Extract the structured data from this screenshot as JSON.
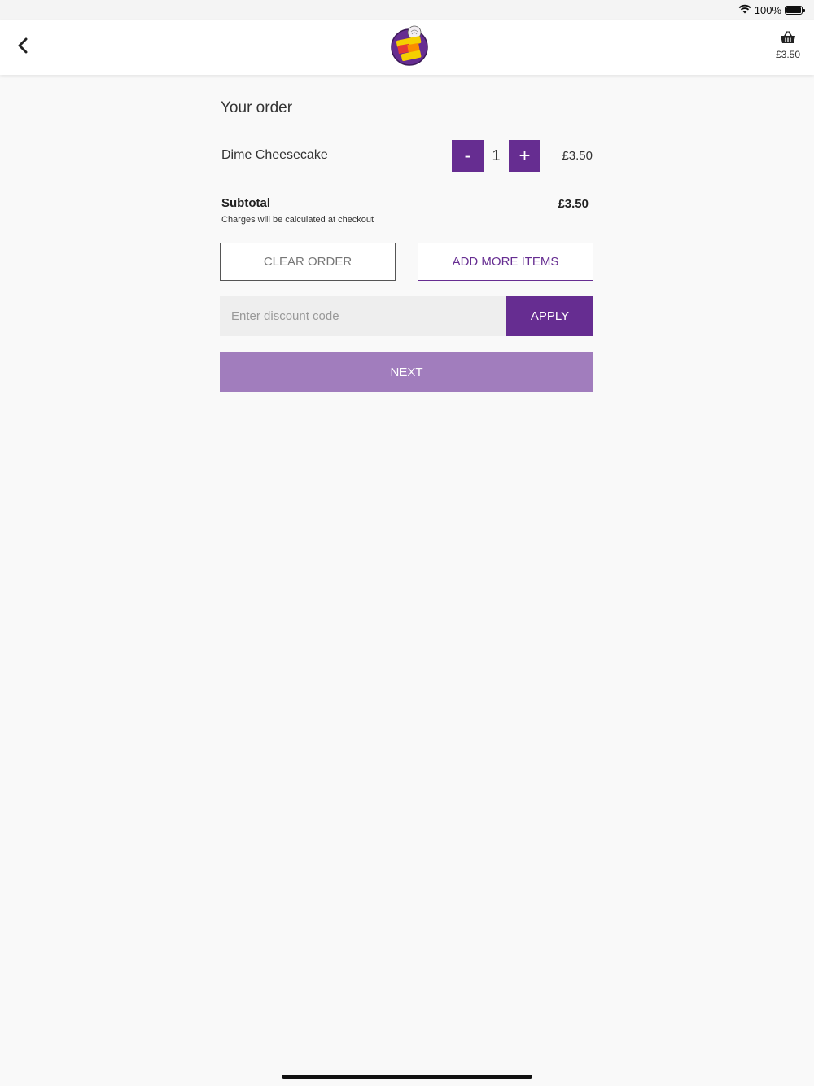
{
  "status_bar": {
    "battery_text": "100%",
    "battery_level": 1.0
  },
  "header": {
    "back_icon": "chevron-left-icon",
    "logo_name": "sweet-shop-logo",
    "basket_icon": "basket-icon",
    "basket_total": "£3.50"
  },
  "order": {
    "title": "Your order",
    "items": [
      {
        "name": "Dime Cheesecake",
        "quantity": "1",
        "price": "£3.50",
        "minus_label": "-",
        "plus_label": "+"
      }
    ],
    "subtotal_label": "Subtotal",
    "subtotal_value": "£3.50",
    "charges_note": "Charges will be calculated at checkout"
  },
  "actions": {
    "clear_label": "CLEAR ORDER",
    "add_more_label": "ADD MORE ITEMS",
    "discount_placeholder": "Enter discount code",
    "apply_label": "APPLY",
    "next_label": "NEXT"
  },
  "colors": {
    "brand": "#662d91",
    "next_button": "#a17dbd",
    "background": "#f9f9f9",
    "discount_field": "#eeeeee"
  }
}
